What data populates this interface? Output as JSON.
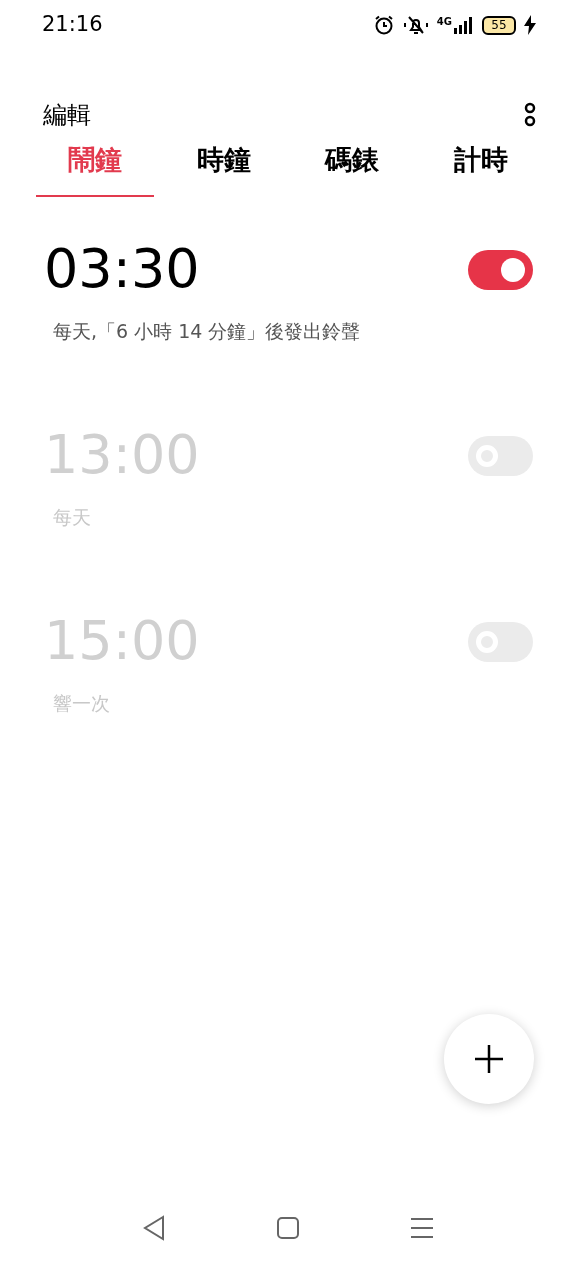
{
  "status_bar": {
    "time": "21:16",
    "network": "4G",
    "battery": "55"
  },
  "header": {
    "title": "編輯"
  },
  "tabs": [
    {
      "label": "鬧鐘",
      "selected": true
    },
    {
      "label": "時鐘",
      "selected": false
    },
    {
      "label": "碼錶",
      "selected": false
    },
    {
      "label": "計時",
      "selected": false
    }
  ],
  "alarms": [
    {
      "time": "03:30",
      "subtitle": "每天,「6 小時 14 分鐘」後發出鈴聲",
      "on": true
    },
    {
      "time": "13:00",
      "subtitle": "每天",
      "on": false
    },
    {
      "time": "15:00",
      "subtitle": "響一次",
      "on": false
    }
  ]
}
